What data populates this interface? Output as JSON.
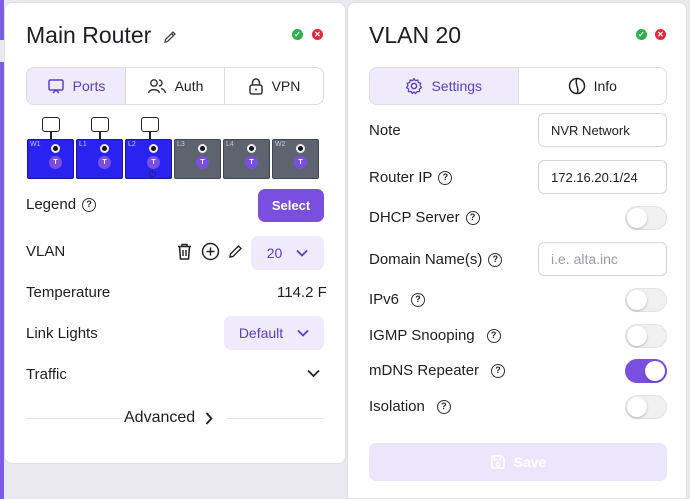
{
  "left": {
    "title": "Main Router",
    "tabs": [
      {
        "label": "Ports",
        "icon": "screen-icon",
        "active": true
      },
      {
        "label": "Auth",
        "icon": "users-icon",
        "active": false
      },
      {
        "label": "VPN",
        "icon": "lock-icon",
        "active": false
      }
    ],
    "ports": [
      {
        "label": "W1",
        "state": "on",
        "badge": "T",
        "uplink": true
      },
      {
        "label": "L1",
        "state": "on",
        "badge": "T",
        "uplink": true
      },
      {
        "label": "L2",
        "state": "on",
        "badge": "T",
        "uplink": true,
        "power": true
      },
      {
        "label": "L3",
        "state": "off",
        "badge": "T"
      },
      {
        "label": "L4",
        "state": "off",
        "badge": "T"
      },
      {
        "label": "W2",
        "state": "off",
        "badge": "T"
      }
    ],
    "legend_label": "Legend",
    "select_label": "Select",
    "vlan_label": "VLAN",
    "vlan_value": "20",
    "temperature_label": "Temperature",
    "temperature_value": "114.2 F",
    "link_lights_label": "Link Lights",
    "link_lights_value": "Default",
    "traffic_label": "Traffic",
    "advanced_label": "Advanced"
  },
  "right": {
    "title": "VLAN 20",
    "tabs": [
      {
        "label": "Settings",
        "icon": "gear-icon",
        "active": true
      },
      {
        "label": "Info",
        "icon": "info-icon",
        "active": false
      }
    ],
    "note_label": "Note",
    "note_value": "NVR Network",
    "router_ip_label": "Router IP",
    "router_ip_value": "172.16.20.1/24",
    "dhcp_label": "DHCP Server",
    "dhcp_on": false,
    "domain_label": "Domain Name(s)",
    "domain_placeholder": "i.e. alta.inc",
    "ipv6_label": "IPv6",
    "ipv6_on": false,
    "igmp_label": "IGMP Snooping",
    "igmp_on": false,
    "mdns_label": "mDNS Repeater",
    "mdns_on": true,
    "isolation_label": "Isolation",
    "isolation_on": false,
    "save_label": "Save"
  },
  "colors": {
    "accent": "#7a4fe0",
    "accent_light": "#efeafc",
    "port_active": "#2a22f0",
    "port_inactive": "#5d6470",
    "status_green": "#2fb14a",
    "status_red": "#e5283b"
  }
}
